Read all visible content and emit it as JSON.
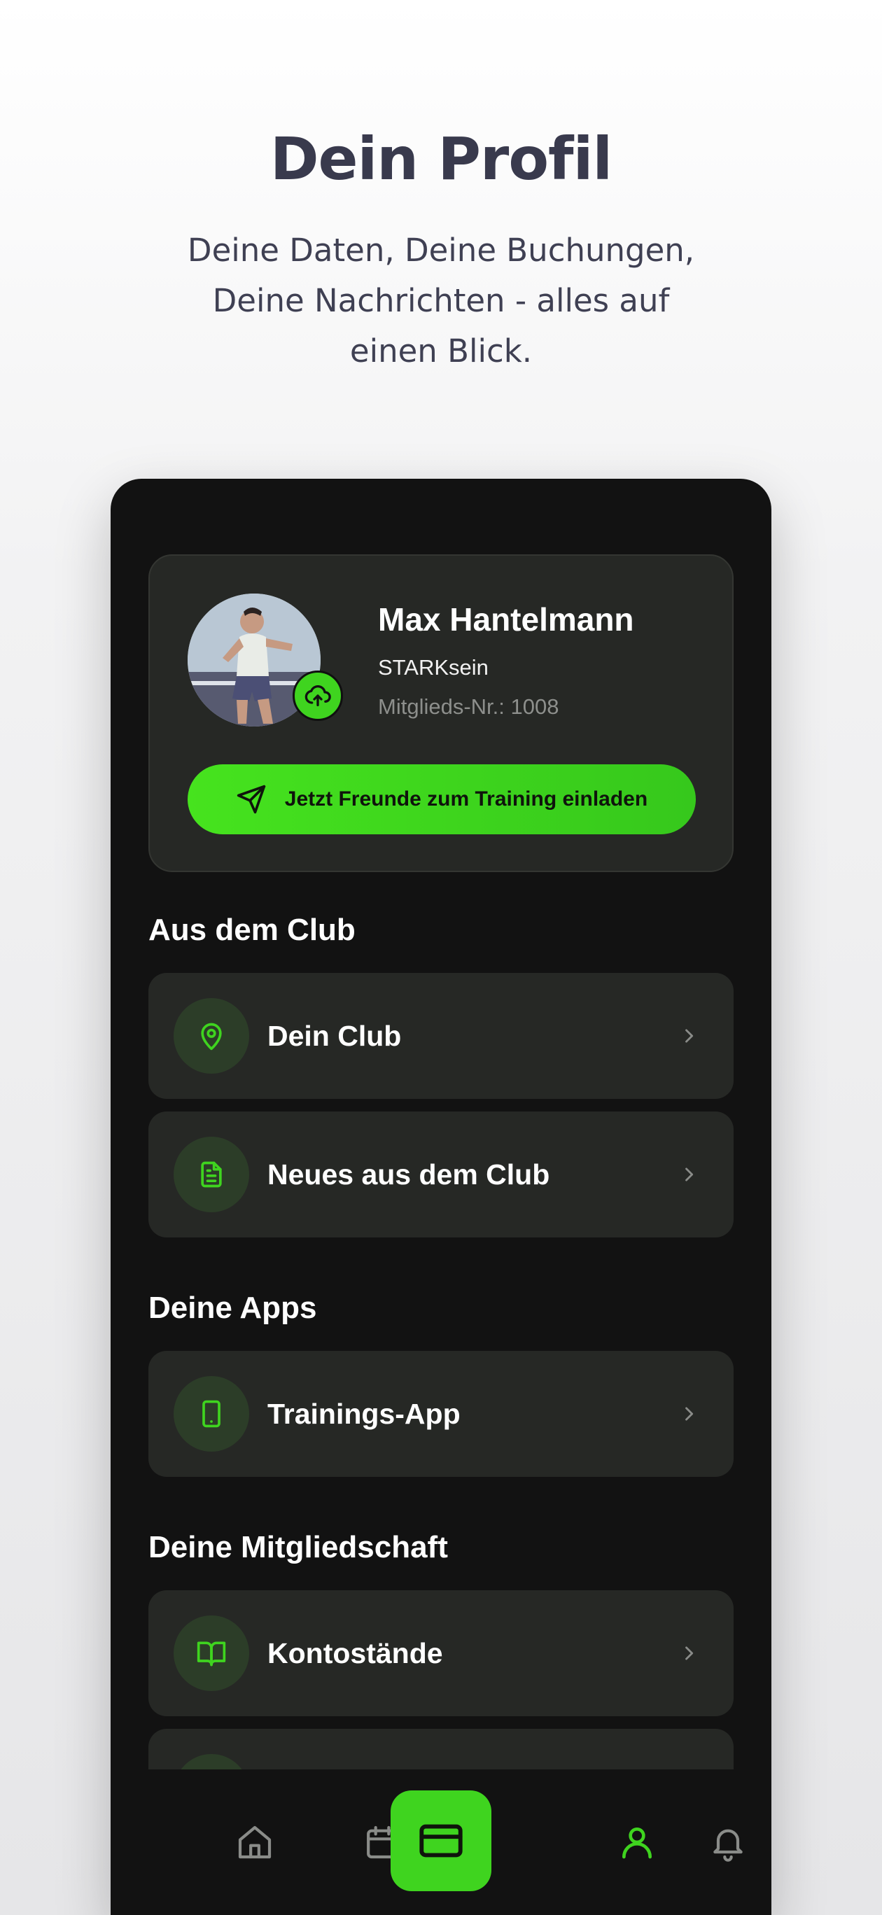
{
  "hero": {
    "title": "Dein Profil",
    "subtitle_line1": "Deine Daten, Deine Buchungen,",
    "subtitle_line2": "Deine Nachrichten - alles auf",
    "subtitle_line3": "einen Blick."
  },
  "profile": {
    "name": "Max Hantelmann",
    "club": "STARKsein",
    "member_number": "Mitglieds-Nr.: 1008",
    "invite_button": "Jetzt Freunde zum Training einladen"
  },
  "sections": {
    "club": {
      "title": "Aus dem Club",
      "items": [
        {
          "label": "Dein Club",
          "icon": "map-pin-icon"
        },
        {
          "label": "Neues aus dem Club",
          "icon": "document-icon"
        }
      ]
    },
    "apps": {
      "title": "Deine Apps",
      "items": [
        {
          "label": "Trainings-App",
          "icon": "smartphone-icon"
        }
      ]
    },
    "membership": {
      "title": "Deine Mitgliedschaft",
      "items": [
        {
          "label": "Kontostände",
          "icon": "book-icon"
        }
      ]
    }
  },
  "nav": {
    "items": [
      "home-icon",
      "calendar-icon",
      "card-icon",
      "user-icon",
      "bell-icon"
    ],
    "active": "user-icon"
  },
  "colors": {
    "accent": "#3fd41f",
    "background": "#121212",
    "card": "#262825",
    "hero_text": "#393a4d"
  }
}
